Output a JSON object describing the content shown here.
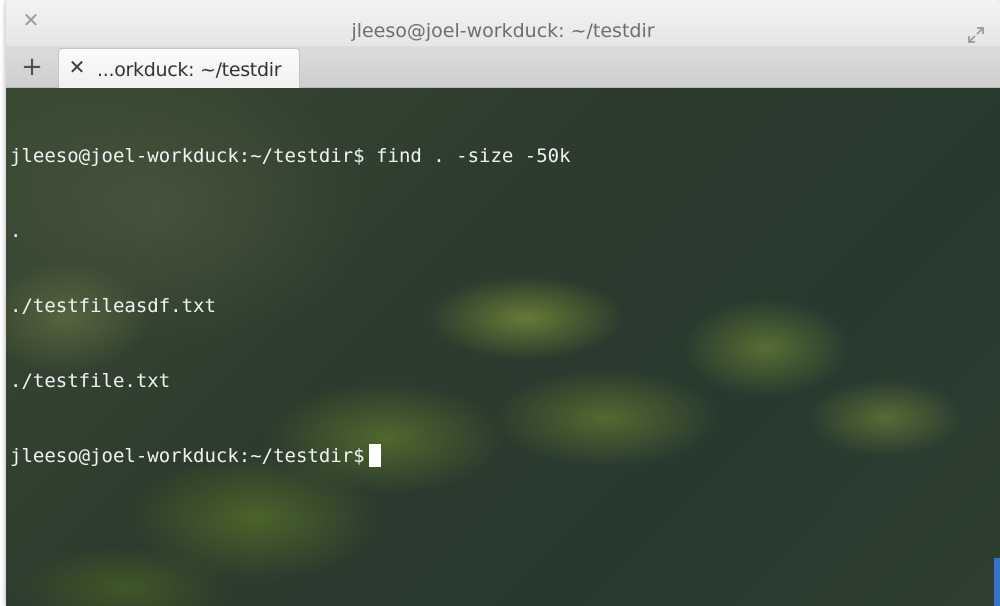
{
  "window": {
    "title": "jleeso@joel-workduck: ~/testdir",
    "close_icon": "close-icon",
    "maximize_icon": "maximize-icon"
  },
  "tabs": {
    "add_label": "+",
    "active_tab": {
      "label": "...orkduck: ~/testdir",
      "close_label": "✕"
    }
  },
  "terminal": {
    "prompt": "jleeso@joel-workduck:~/testdir$",
    "command": "find . -size -50k",
    "output": [
      ".",
      "./testfileasdf.txt",
      "./testfile.txt"
    ],
    "current_prompt": "jleeso@joel-workduck:~/testdir$"
  },
  "colors": {
    "text": "#f2f2f2",
    "scroll_accent": "#3a73c6"
  }
}
